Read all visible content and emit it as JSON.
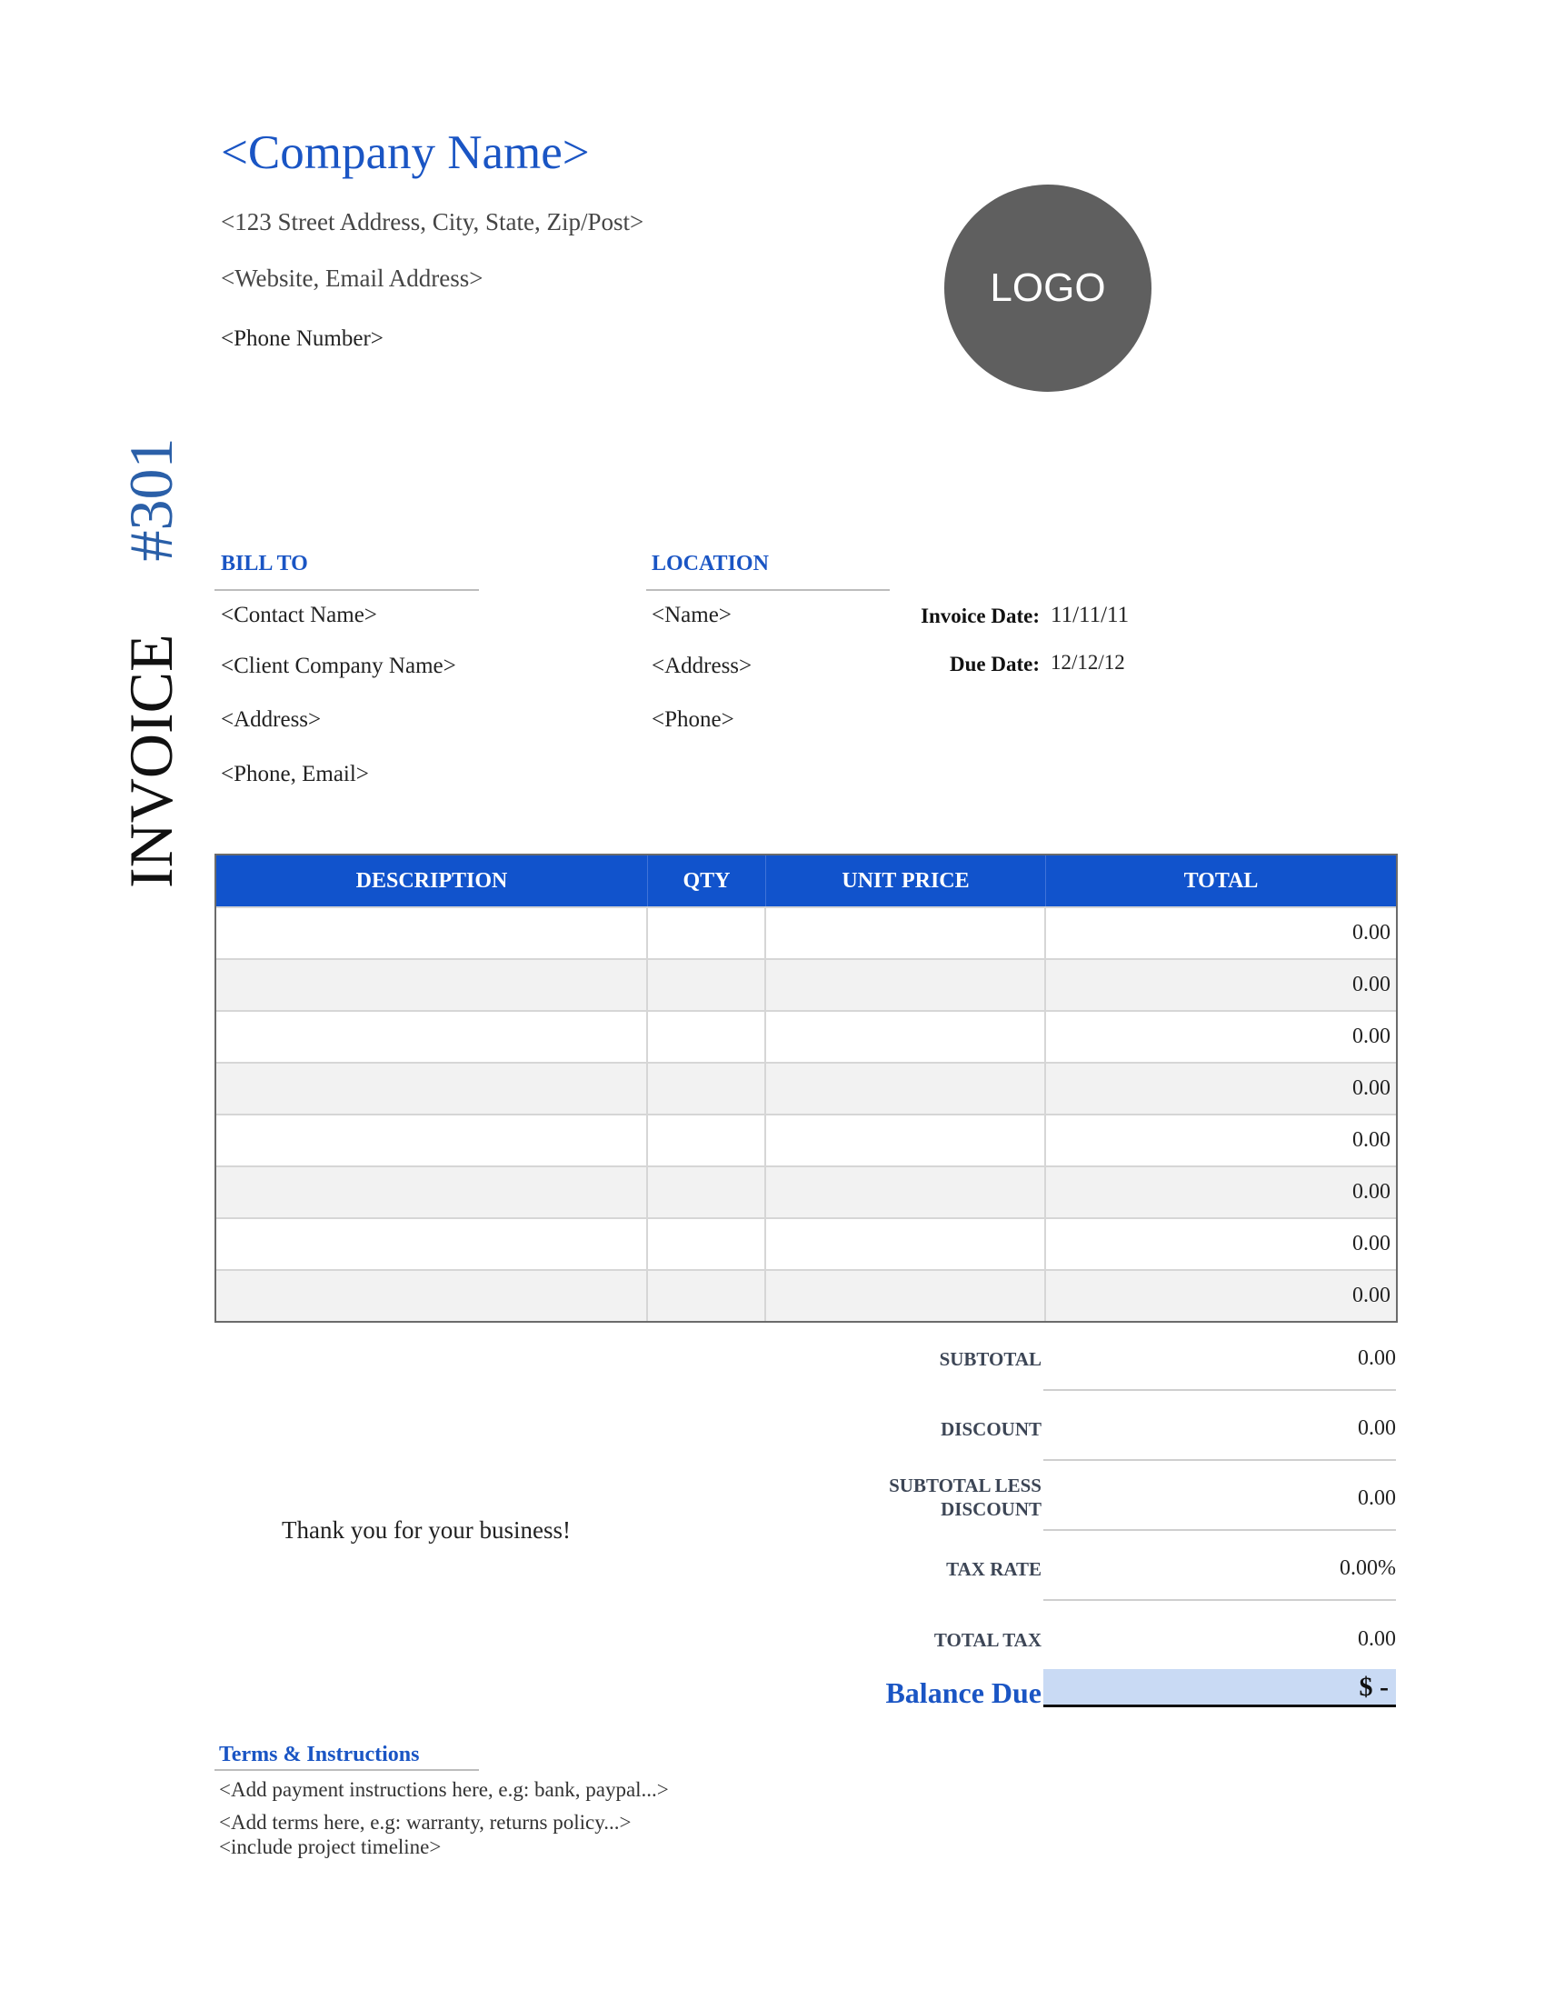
{
  "company": {
    "name": "<Company Name>",
    "address": "<123 Street Address, City, State, Zip/Post>",
    "web_email": "<Website, Email Address>",
    "phone": "<Phone Number>",
    "logo_text": "LOGO"
  },
  "invoice": {
    "title": "INVOICE",
    "number": "#301"
  },
  "bill_to": {
    "heading": "BILL TO",
    "contact": "<Contact Name>",
    "company": "<Client Company Name>",
    "address": "<Address>",
    "phone_email": "<Phone, Email>"
  },
  "location": {
    "heading": "LOCATION",
    "name": "<Name>",
    "address": "<Address>",
    "phone": "<Phone>"
  },
  "dates": {
    "invoice_date_label": "Invoice Date:",
    "invoice_date": "11/11/11",
    "due_date_label": "Due Date:",
    "due_date": "12/12/12"
  },
  "table": {
    "headers": [
      "DESCRIPTION",
      "QTY",
      "UNIT PRICE",
      "TOTAL"
    ],
    "rows": [
      {
        "description": "",
        "qty": "",
        "unit_price": "",
        "total": "0.00"
      },
      {
        "description": "",
        "qty": "",
        "unit_price": "",
        "total": "0.00"
      },
      {
        "description": "",
        "qty": "",
        "unit_price": "",
        "total": "0.00"
      },
      {
        "description": "",
        "qty": "",
        "unit_price": "",
        "total": "0.00"
      },
      {
        "description": "",
        "qty": "",
        "unit_price": "",
        "total": "0.00"
      },
      {
        "description": "",
        "qty": "",
        "unit_price": "",
        "total": "0.00"
      },
      {
        "description": "",
        "qty": "",
        "unit_price": "",
        "total": "0.00"
      },
      {
        "description": "",
        "qty": "",
        "unit_price": "",
        "total": "0.00"
      }
    ]
  },
  "summary": {
    "subtotal_label": "SUBTOTAL",
    "subtotal": "0.00",
    "discount_label": "DISCOUNT",
    "discount": "0.00",
    "subtotal_less_discount_label_1": "SUBTOTAL LESS",
    "subtotal_less_discount_label_2": "DISCOUNT",
    "subtotal_less_discount": "0.00",
    "tax_rate_label": "TAX RATE",
    "tax_rate": "0.00%",
    "total_tax_label": "TOTAL TAX",
    "total_tax": "0.00",
    "balance_due_label": "Balance Due",
    "balance_due": "$ -"
  },
  "thanks": "Thank you for your business!",
  "terms": {
    "heading": "Terms & Instructions",
    "line1": "<Add payment instructions here, e.g: bank, paypal...>",
    "line2": "<Add terms here, e.g: warranty, returns policy...>",
    "line3": "<include project timeline>"
  },
  "colors": {
    "accent_blue": "#1a55c4",
    "header_bar": "#1153cc",
    "balance_fill": "#c9daf4",
    "logo_fill": "#5f5f5f"
  }
}
